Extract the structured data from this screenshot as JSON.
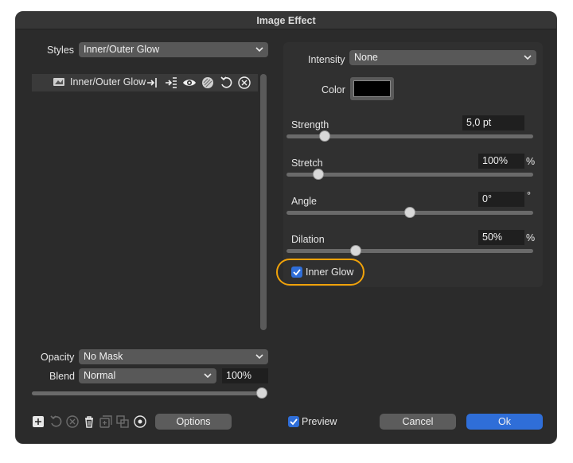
{
  "window": {
    "title": "Image Effect"
  },
  "left": {
    "styles_label": "Styles",
    "styles_value": "Inner/Outer Glow",
    "list_item": "Inner/Outer Glow",
    "opacity_label": "Opacity",
    "opacity_value": "No Mask",
    "blend_label": "Blend",
    "blend_value": "Normal",
    "blend_percent": "100%",
    "opacity_slider_fraction": 1.0,
    "options_label": "Options"
  },
  "right": {
    "intensity_label": "Intensity",
    "intensity_value": "None",
    "color_label": "Color",
    "color_swatch": "#000000",
    "strength_label": "Strength",
    "strength_value": "5,0 pt",
    "strength_fraction": 0.14,
    "stretch_label": "Stretch",
    "stretch_value": "100%",
    "stretch_unit": "%",
    "stretch_fraction": 0.11,
    "angle_label": "Angle",
    "angle_value": "0°",
    "angle_unit": "°",
    "angle_fraction": 0.5,
    "dilation_label": "Dilation",
    "dilation_value": "50%",
    "dilation_unit": "%",
    "dilation_fraction": 0.27,
    "inner_glow_label": "Inner Glow",
    "inner_glow_checked": true
  },
  "footer": {
    "preview_label": "Preview",
    "preview_checked": true,
    "cancel_label": "Cancel",
    "ok_label": "Ok"
  },
  "colors": {
    "accent": "#2f6ed8",
    "highlight": "#f0a20a"
  },
  "icons": [
    "add-icon",
    "reset-icon",
    "clear-icon",
    "trash-icon",
    "duplicate-icon",
    "merge-icon",
    "target-icon",
    "fx-icon",
    "move-in-icon",
    "move-list-icon",
    "eye-icon",
    "layers-icon",
    "undo-icon",
    "close-circle-icon"
  ]
}
